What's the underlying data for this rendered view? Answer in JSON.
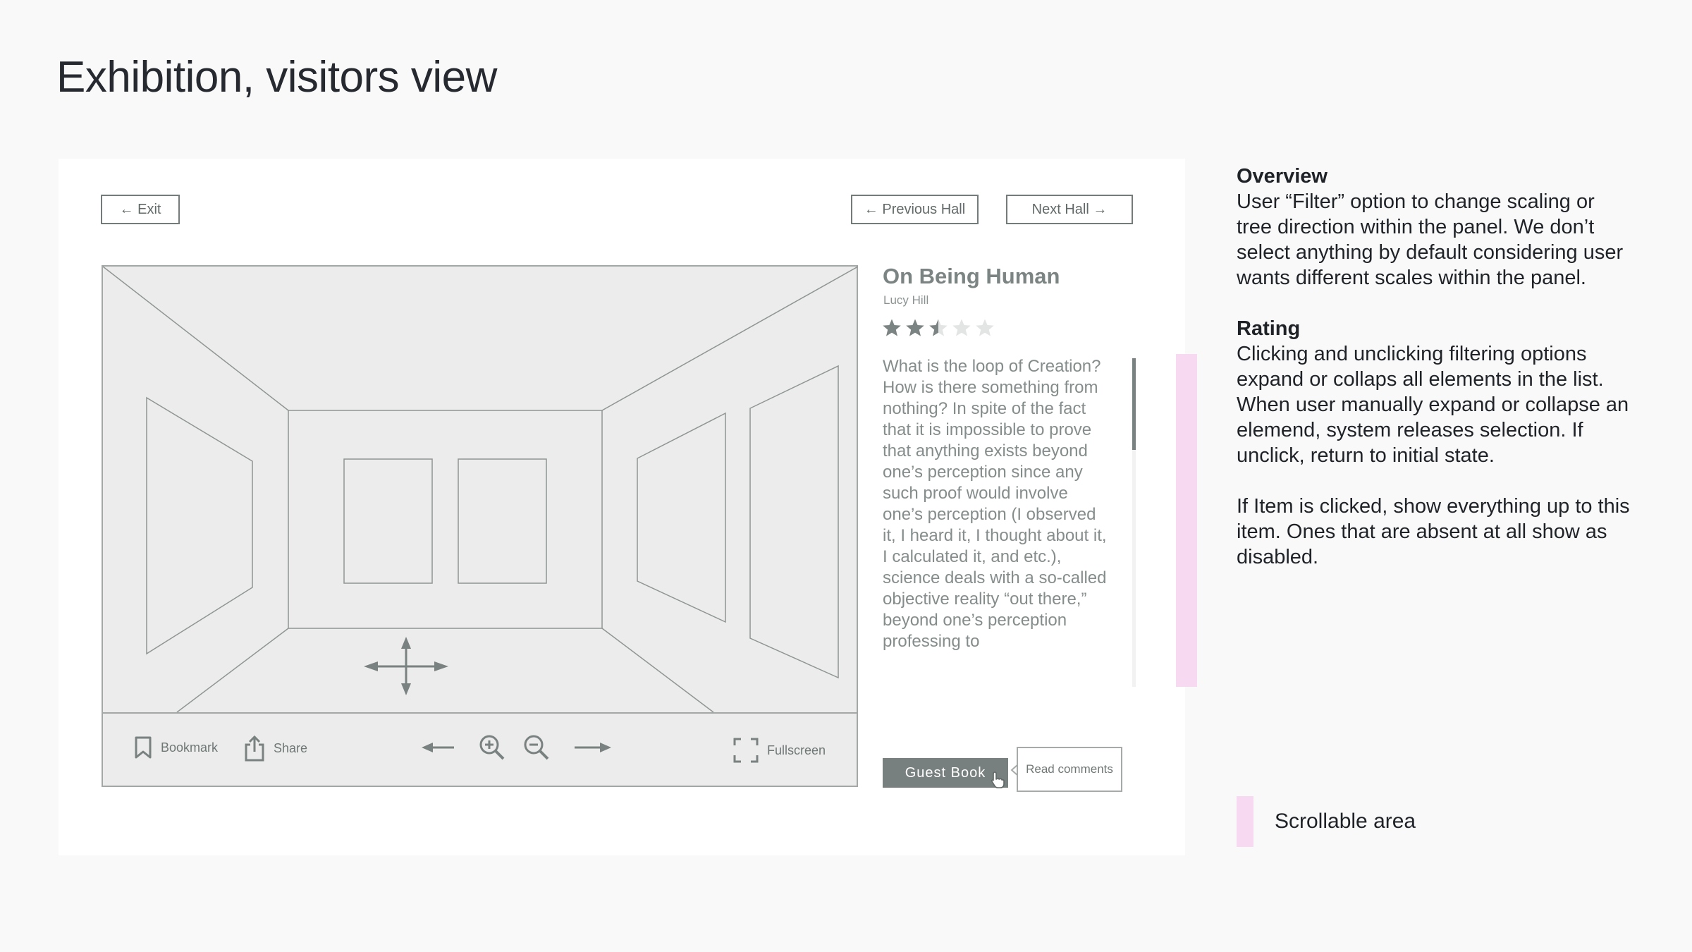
{
  "page": {
    "title": "Exhibition, visitors view"
  },
  "nav": {
    "exit_label": "← Exit",
    "prev_label": "← Previous Hall",
    "next_label": "Next Hall →"
  },
  "toolbar": {
    "bookmark_label": "Bookmark",
    "share_label": "Share",
    "fullscreen_label": "Fullscreen"
  },
  "artwork": {
    "title": "On Being Human",
    "author": "Lucy Hill",
    "rating": 2.5,
    "rating_max": 5,
    "description": "What is the loop of Creation? How is there something from nothing? In spite of the fact that it is impossible to prove that anything exists beyond one’s perception since any such proof would involve one’s perception (I observed it, I heard it, I thought about it, I calculated it, and etc.), science deals with a so-called objective reality “out there,” beyond one’s perception professing to"
  },
  "guestbook": {
    "button_label": "Guest Book",
    "tooltip_label": "Read comments"
  },
  "notes": {
    "overview_heading": "Overview",
    "overview_text": "User “Filter” option to change scaling or tree direction within the panel. We don’t select anything by default considering user wants different scales within the panel.",
    "rating_heading": "Rating",
    "rating_text": "Clicking and unclicking filtering options expand or collaps all elements in the list. When user manually expand or collapse an elemend, system releases selection. If unclick, return to initial state.",
    "item_text": "If Item is clicked, show everything up to this item. Ones that are absent at all show as disabled."
  },
  "legend": {
    "scrollable_label": "Scrollable area"
  },
  "colors": {
    "accent": "#78807f",
    "scroll_marker": "#f7d9f2",
    "star_filled": "#7b8483",
    "star_empty": "#e3e5e4"
  }
}
